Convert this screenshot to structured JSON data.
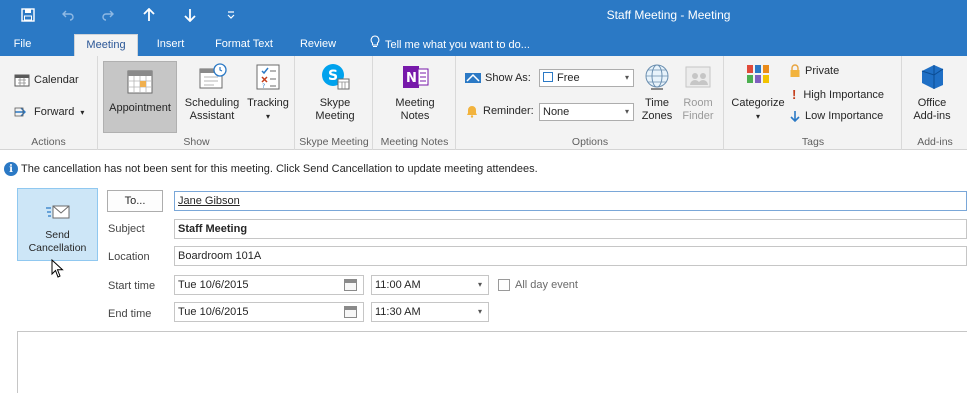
{
  "window": {
    "title": "Staff Meeting - Meeting",
    "titlebar_color": "#2b79c5",
    "qat_icons": [
      "save-icon",
      "undo-icon",
      "redo-icon",
      "previous-item-icon",
      "next-item-icon",
      "customize-qat-icon"
    ]
  },
  "tabs": [
    {
      "label": "File",
      "active": false
    },
    {
      "label": "Meeting",
      "active": true
    },
    {
      "label": "Insert",
      "active": false
    },
    {
      "label": "Format Text",
      "active": false
    },
    {
      "label": "Review",
      "active": false
    }
  ],
  "tell_me": "Tell me what you want to do...",
  "ribbon": {
    "actions": {
      "label": "Actions",
      "calendar": "Calendar",
      "forward": "Forward"
    },
    "show": {
      "label": "Show",
      "appointment": "Appointment",
      "scheduling_1": "Scheduling",
      "scheduling_2": "Assistant",
      "tracking": "Tracking"
    },
    "skype": {
      "label": "Skype Meeting",
      "btn_1": "Skype",
      "btn_2": "Meeting"
    },
    "meeting_notes": {
      "label": "Meeting Notes",
      "btn_1": "Meeting",
      "btn_2": "Notes"
    },
    "options": {
      "label": "Options",
      "show_as_label": "Show As:",
      "show_as_value": "Free",
      "reminder_label": "Reminder:",
      "reminder_value": "None",
      "time_zones_1": "Time",
      "time_zones_2": "Zones",
      "room_finder_1": "Room",
      "room_finder_2": "Finder"
    },
    "tags": {
      "label": "Tags",
      "categorize": "Categorize",
      "private": "Private",
      "high_importance": "High Importance",
      "low_importance": "Low Importance"
    },
    "addins": {
      "label": "Add-ins",
      "btn_1": "Office",
      "btn_2": "Add-ins"
    }
  },
  "info_message": "The cancellation has not been sent for this meeting. Click Send Cancellation to update meeting attendees.",
  "form": {
    "send_1": "Send",
    "send_2": "Cancellation",
    "to_button": "To...",
    "to_value": "Jane Gibson",
    "subject_label": "Subject",
    "subject_value": "Staff Meeting",
    "location_label": "Location",
    "location_value": "Boardroom 101A",
    "start_label": "Start time",
    "start_date": "Tue 10/6/2015",
    "start_time": "11:00 AM",
    "all_day": "All day event",
    "all_day_checked": false,
    "end_label": "End time",
    "end_date": "Tue 10/6/2015",
    "end_time": "11:30 AM"
  }
}
